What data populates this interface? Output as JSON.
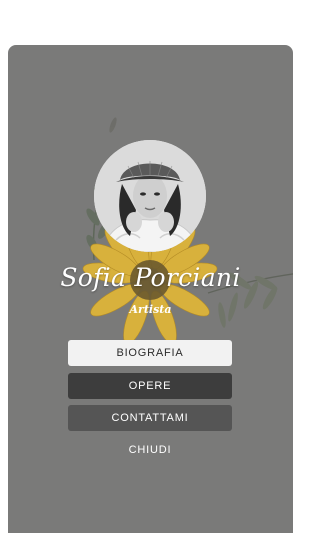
{
  "profile": {
    "name": "Sofia Porciani",
    "role": "Artista"
  },
  "menu": {
    "biography_label": "BIOGRAFIA",
    "works_label": "OPERE",
    "contact_label": "CONTATTAMI",
    "close_label": "CHIUDI"
  },
  "colors": {
    "card_background": "#7a7a79",
    "sunflower_petal": "#e0b637",
    "button_light": "#f2f2f2",
    "button_dark": "#3d3d3d",
    "button_mid": "#555555"
  },
  "icons": {
    "decoration": "sunflower-illustration",
    "foliage": "leaf-branch-illustration"
  }
}
